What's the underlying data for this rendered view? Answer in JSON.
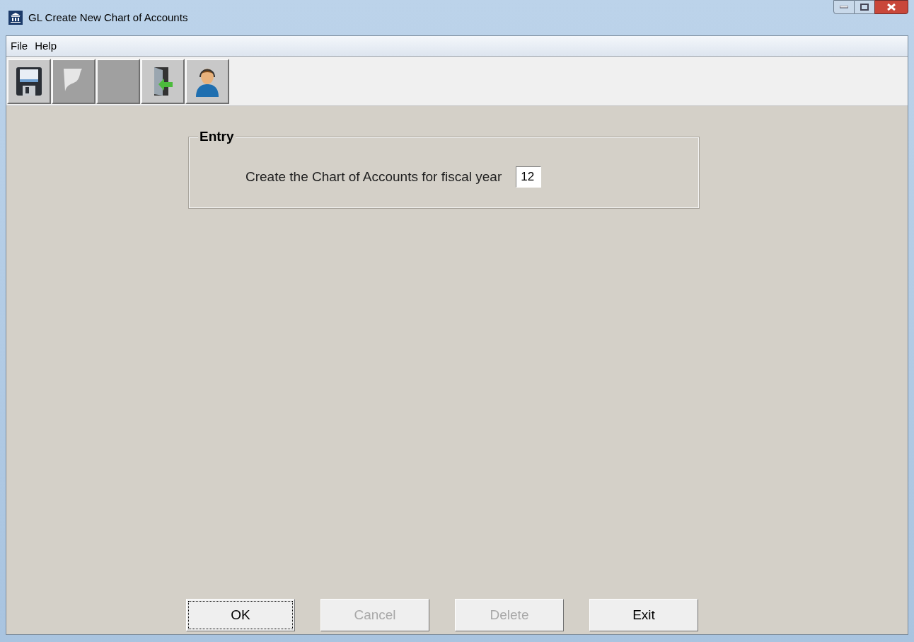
{
  "window": {
    "title": "GL Create New Chart of Accounts"
  },
  "menu": [
    "File",
    "Help"
  ],
  "toolbar": [
    {
      "kind": "save",
      "disabled": false
    },
    {
      "kind": "page",
      "disabled": true
    },
    {
      "kind": "blank",
      "disabled": true
    },
    {
      "kind": "exit",
      "disabled": false
    },
    {
      "kind": "support",
      "disabled": false
    }
  ],
  "entry": {
    "legend": "Entry",
    "label": "Create the Chart of Accounts for fiscal year",
    "value": "12"
  },
  "buttons": [
    {
      "label": "OK",
      "disabled": false,
      "focused": true
    },
    {
      "label": "Cancel",
      "disabled": true,
      "focused": false
    },
    {
      "label": "Delete",
      "disabled": true,
      "focused": false
    },
    {
      "label": "Exit",
      "disabled": false,
      "focused": false
    }
  ]
}
